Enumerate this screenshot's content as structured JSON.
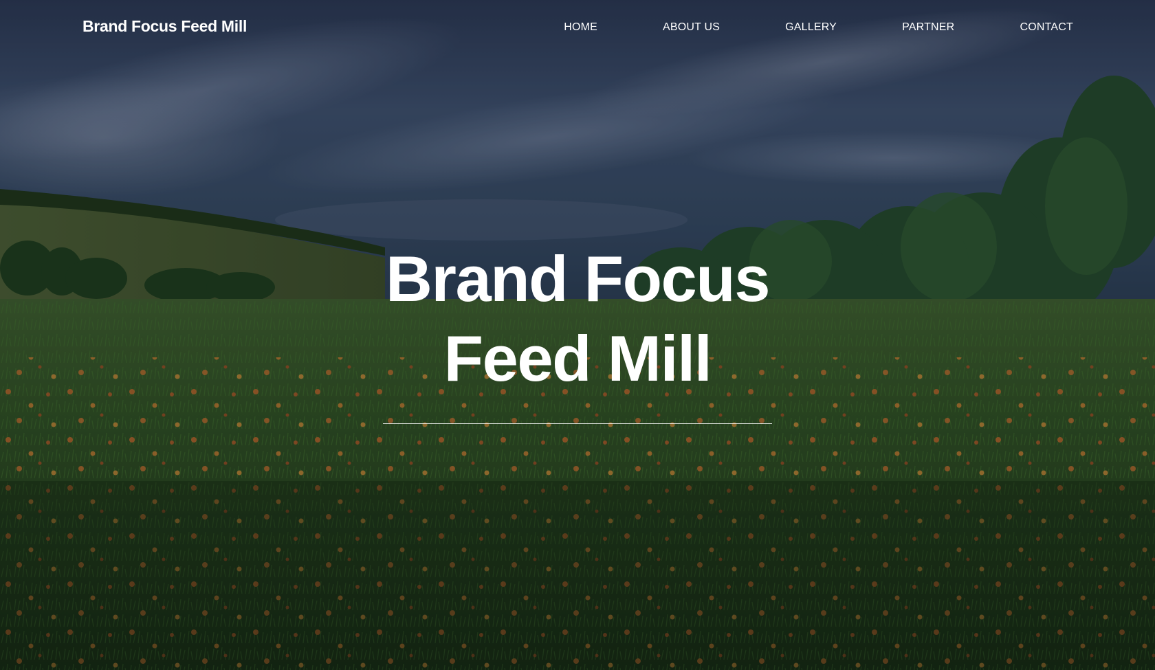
{
  "site": {
    "brand": "Brand Focus Feed Mill"
  },
  "nav": {
    "items": [
      {
        "label": "HOME"
      },
      {
        "label": "ABOUT US"
      },
      {
        "label": "GALLERY"
      },
      {
        "label": "PARTNER"
      },
      {
        "label": "CONTACT"
      }
    ]
  },
  "hero": {
    "title_line1": "Brand Focus",
    "title_line2": "Feed Mill",
    "background": "meadow with orange wildflowers, green hills and trees under a dark cloudy sky"
  },
  "colors": {
    "text": "#ffffff",
    "sky": "#3a4a66",
    "field": "#2c4a22",
    "flowers": "#c8632a"
  }
}
